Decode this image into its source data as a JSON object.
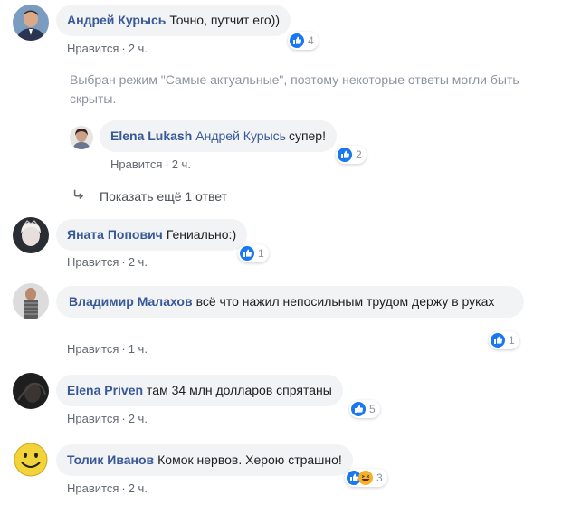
{
  "comments": [
    {
      "id": "c1",
      "author": "Андрей Курысь",
      "text": "Точно, путчит его))",
      "like_label": "Нравится",
      "time": "2 ч.",
      "reaction_count": "4",
      "reactions": [
        "like-icon"
      ]
    },
    {
      "id": "c2",
      "author": "Яната Попович",
      "text": "Гениально:)",
      "like_label": "Нравится",
      "time": "2 ч.",
      "reaction_count": "1",
      "reactions": [
        "like-icon"
      ]
    },
    {
      "id": "c3",
      "author": "Владимир Малахов",
      "text": "всё что нажил непосильным трудом держу в руках",
      "like_label": "Нравится",
      "time": "1 ч.",
      "reaction_count": "1",
      "reactions": [
        "like-icon"
      ]
    },
    {
      "id": "c4",
      "author": "Elena Priven",
      "text": "там 34 млн долларов спрятаны",
      "like_label": "Нравится",
      "time": "2 ч.",
      "reaction_count": "5",
      "reactions": [
        "like-icon"
      ]
    },
    {
      "id": "c5",
      "author": "Толик Иванов",
      "text": "Комок нервов. Херою страшно!",
      "like_label": "Нравится",
      "time": "2 ч.",
      "reaction_count": "3",
      "reactions": [
        "like-icon",
        "haha-icon"
      ]
    }
  ],
  "notice": "Выбран режим \"Самые актуальные\", поэтому некоторые ответы могли быть скрыты.",
  "reply": {
    "author": "Elena Lukash",
    "mention": "Андрей Курысь",
    "text": "супер!",
    "like_label": "Нравится",
    "time": "2 ч.",
    "reaction_count": "2",
    "reactions": [
      "like-icon"
    ]
  },
  "more_replies": {
    "label": "Показать ещё 1 ответ",
    "icon": "reply-arrow-icon"
  },
  "separator": "·",
  "colors": {
    "name": "#385898",
    "bubble": "#f2f3f5",
    "meta": "#616770",
    "like_blue": "#1877f2",
    "haha_yellow": "#f7b125"
  }
}
